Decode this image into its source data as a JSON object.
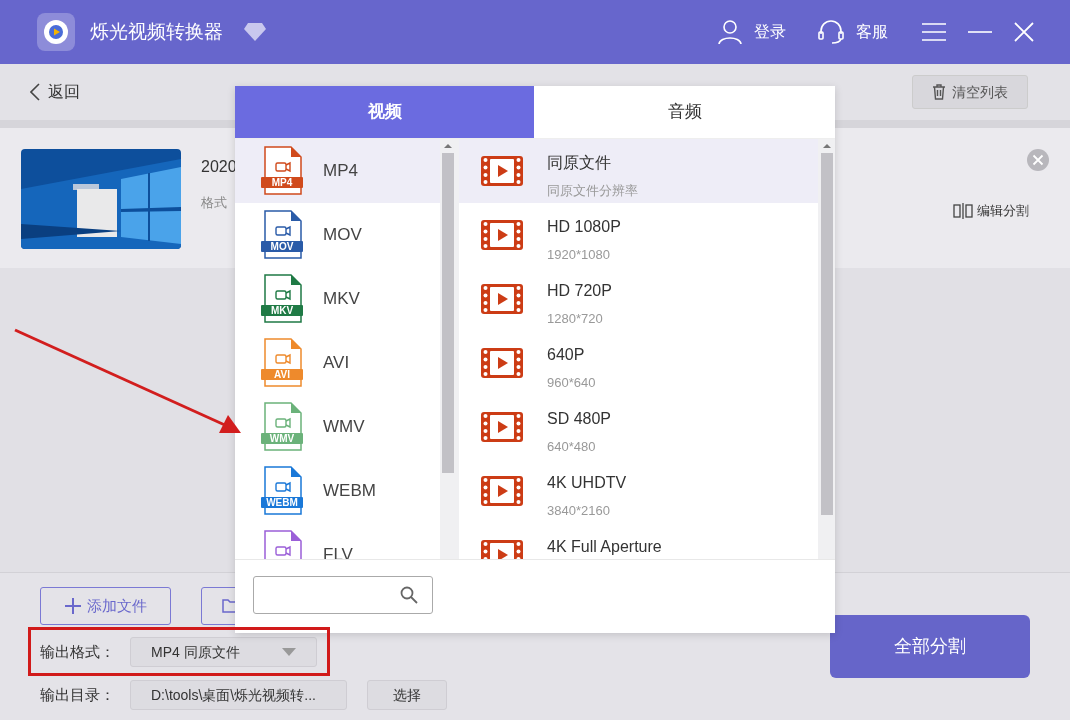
{
  "window": {
    "title": "烁光视频转换器",
    "login": "登录",
    "support": "客服"
  },
  "toolbar": {
    "back": "返回",
    "clear": "清空列表"
  },
  "file": {
    "name": "2020",
    "format_label": "格式",
    "edit_split": "编辑分割"
  },
  "popup": {
    "tabs": [
      {
        "label": "视频",
        "selected": true
      },
      {
        "label": "音频",
        "selected": false
      }
    ],
    "formats": [
      {
        "label": "MP4",
        "tag": "MP4",
        "color": "#d04a1c",
        "selected": true
      },
      {
        "label": "MOV",
        "tag": "MOV",
        "color": "#2a5ba8",
        "selected": false
      },
      {
        "label": "MKV",
        "tag": "MKV",
        "color": "#1f7a45",
        "selected": false
      },
      {
        "label": "AVI",
        "tag": "AVI",
        "color": "#ee8a2c",
        "selected": false
      },
      {
        "label": "WMV",
        "tag": "WMV",
        "color": "#6bb27a",
        "selected": false
      },
      {
        "label": "WEBM",
        "tag": "WEBM",
        "color": "#1a78d8",
        "selected": false
      },
      {
        "label": "FLV",
        "color": "#9b5fd8",
        "selected": false
      }
    ],
    "presets": [
      {
        "name": "同原文件",
        "resolution": "同原文件分辨率",
        "selected": true
      },
      {
        "name": "HD 1080P",
        "resolution": "1920*1080",
        "selected": false
      },
      {
        "name": "HD 720P",
        "resolution": "1280*720",
        "selected": false
      },
      {
        "name": "640P",
        "resolution": "960*640",
        "selected": false
      },
      {
        "name": "SD 480P",
        "resolution": "640*480",
        "selected": false
      },
      {
        "name": "4K UHDTV",
        "resolution": "3840*2160",
        "selected": false
      },
      {
        "name": "4K Full Aperture",
        "selected": false
      }
    ]
  },
  "bottom": {
    "add_file": "添加文件",
    "output_format_label": "输出格式：",
    "output_format_value": "MP4 同原文件",
    "output_dir_label": "输出目录：",
    "output_dir_value": "D:\\tools\\桌面\\烁光视频转...",
    "choose": "选择",
    "split_all": "全部分割"
  }
}
